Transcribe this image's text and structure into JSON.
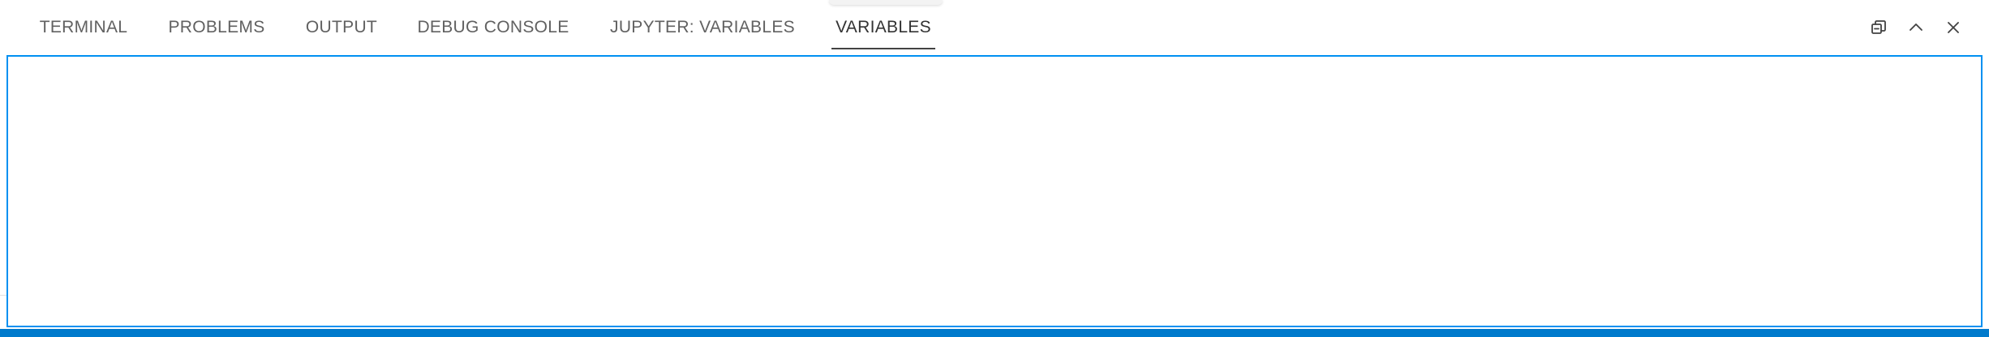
{
  "tabs": [
    {
      "id": "terminal",
      "label": "TERMINAL",
      "active": false
    },
    {
      "id": "problems",
      "label": "PROBLEMS",
      "active": false
    },
    {
      "id": "output",
      "label": "OUTPUT",
      "active": false
    },
    {
      "id": "debug_console",
      "label": "DEBUG CONSOLE",
      "active": false
    },
    {
      "id": "jupyter_variables",
      "label": "JUPYTER: VARIABLES",
      "active": false
    },
    {
      "id": "variables",
      "label": "VARIABLES",
      "active": true
    }
  ],
  "actions": [
    {
      "id": "restore",
      "icon": "restore-panel-icon"
    },
    {
      "id": "maximize",
      "icon": "chevron-up-icon"
    },
    {
      "id": "close",
      "icon": "close-icon"
    }
  ],
  "colors": {
    "focus_border": "#0090f1",
    "status_bar": "#007acc",
    "active_tab_text": "#333333",
    "inactive_tab_text": "#616161"
  }
}
